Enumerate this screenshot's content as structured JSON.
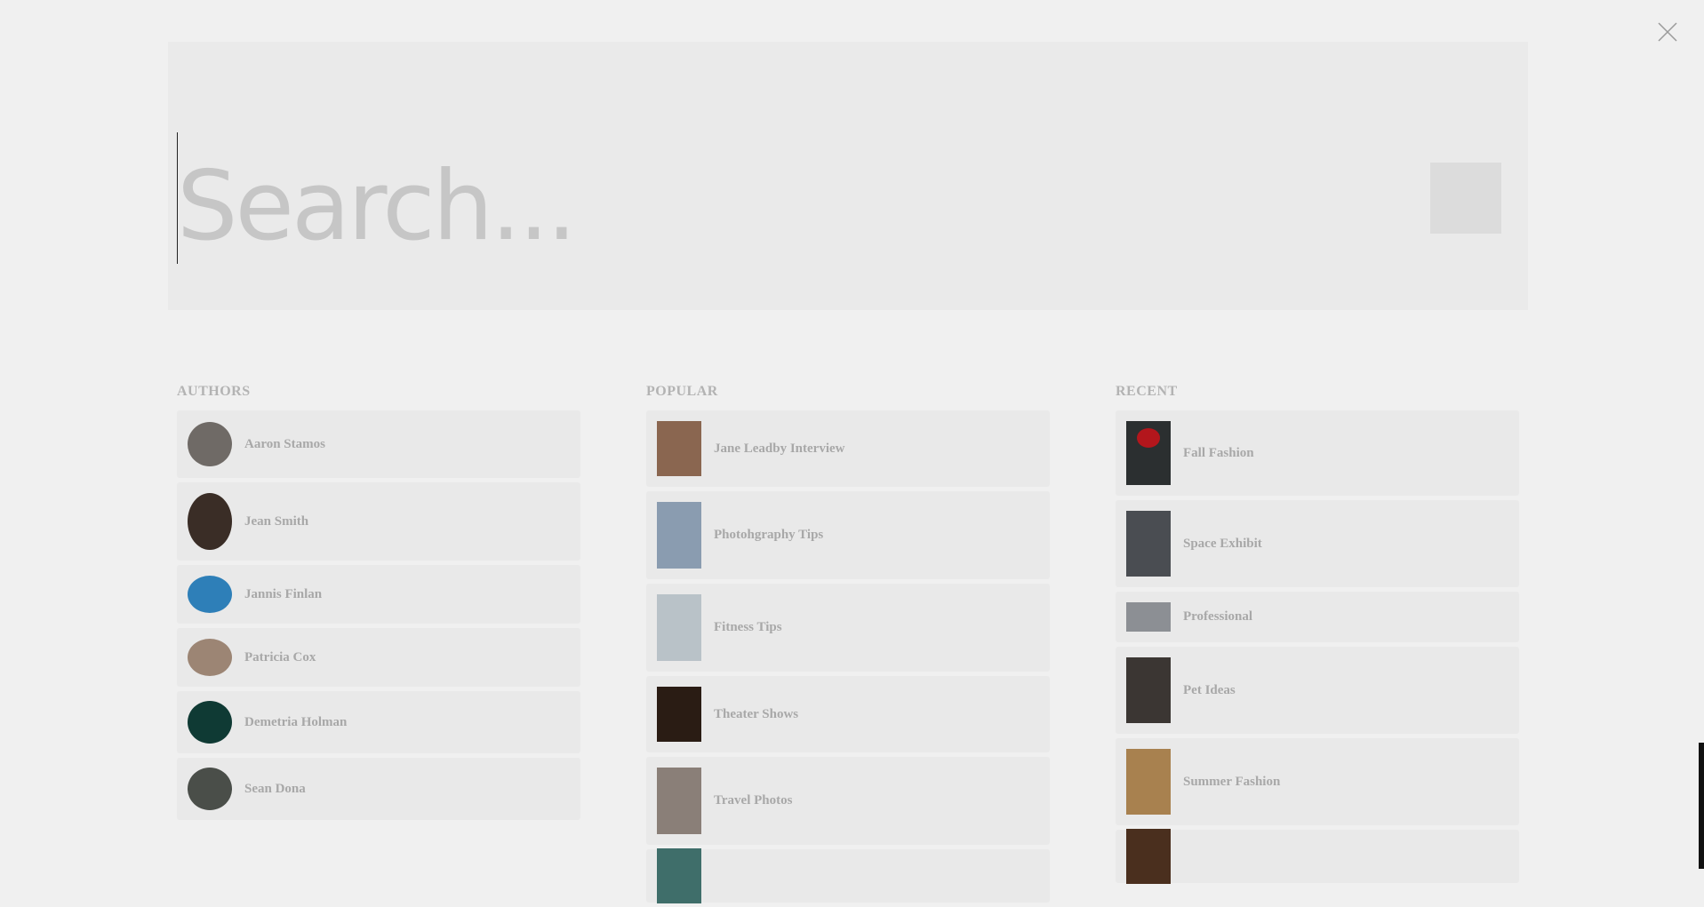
{
  "search": {
    "placeholder": "Search..."
  },
  "authors": {
    "title": "AUTHORS",
    "items": [
      {
        "name": "Aaron Stamos",
        "avatar_color": "#6f6a66"
      },
      {
        "name": "Jean Smith",
        "avatar_color": "#3a2d26"
      },
      {
        "name": "Jannis Finlan",
        "avatar_color": "#2e7fb8"
      },
      {
        "name": "Patricia Cox",
        "avatar_color": "#9c8574"
      },
      {
        "name": "Demetria Holman",
        "avatar_color": "#0f3a34"
      },
      {
        "name": "Sean Dona",
        "avatar_color": "#4a4e49"
      }
    ]
  },
  "popular": {
    "title": "POPULAR",
    "items": [
      {
        "label": "Jane Leadby Interview",
        "thumb_color": "#8a6650"
      },
      {
        "label": "Photohgraphy Tips",
        "thumb_color": "#8a9cb0"
      },
      {
        "label": "Fitness Tips",
        "thumb_color": "#b9c2c8"
      },
      {
        "label": "Theater Shows",
        "thumb_color": "#2a1c14"
      },
      {
        "label": "Travel Photos",
        "thumb_color": "#8a7f78"
      },
      {
        "label": "",
        "thumb_color": "#3f6e6a"
      }
    ]
  },
  "recent": {
    "title": "RECENT",
    "items": [
      {
        "label": "Fall Fashion",
        "thumb_color": "#2b2f30",
        "accent": "#b3161c"
      },
      {
        "label": "Space Exhibit",
        "thumb_color": "#4a4d52"
      },
      {
        "label": "Professional",
        "thumb_color": "#8c8f94"
      },
      {
        "label": "Pet Ideas",
        "thumb_color": "#3b3633"
      },
      {
        "label": "Summer Fashion",
        "thumb_color": "#a8814f"
      },
      {
        "label": "",
        "thumb_color": "#4a2f1e"
      }
    ]
  }
}
